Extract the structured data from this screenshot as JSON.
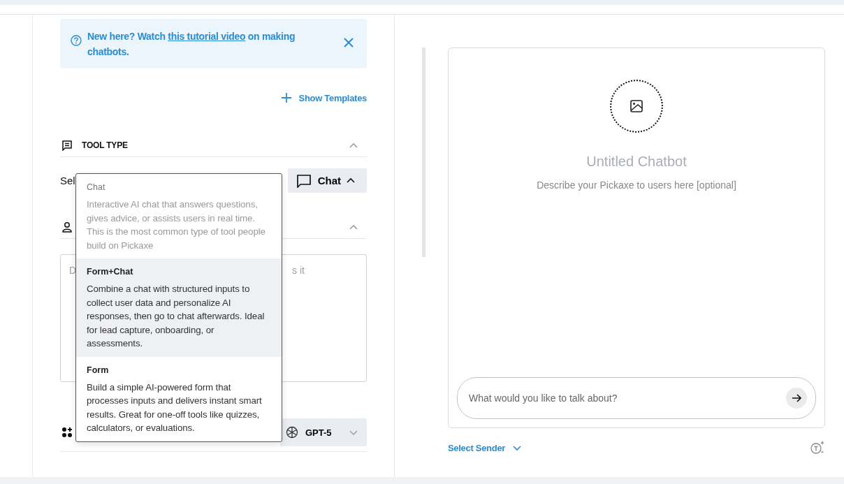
{
  "notice": {
    "text_before": "New here? Watch ",
    "link": "this tutorial video",
    "text_after": " on making chatbots."
  },
  "show_templates": "Show Templates",
  "tool_type": {
    "title": "TOOL TYPE",
    "expanded": true,
    "label": "Sel",
    "button": {
      "label": "Chat",
      "expanded": true
    }
  },
  "dropdown": [
    {
      "title": "Chat",
      "description": "Interactive AI chat that answers questions, gives advice, or assists users in real time. This is the most common type of tool people build on Pickaxe",
      "selected": true,
      "highlighted": false
    },
    {
      "title": "Form+Chat",
      "description": "Combine a chat with structured inputs to collect user data and personalize AI responses, then go to chat afterwards. Ideal for lead capture, onboarding, or assessments.",
      "selected": false,
      "highlighted": true
    },
    {
      "title": "Form",
      "description": "Build a simple AI-powered form that processes inputs and delivers instant smart results. Great for one-off tools like quizzes, calculators, or evaluations.",
      "selected": false,
      "highlighted": false
    }
  ],
  "role_section": {
    "expanded": true,
    "placeholder_start": "D",
    "placeholder_end": "s it"
  },
  "model": {
    "label": "GPT-5",
    "expanded": false
  },
  "preview": {
    "title": "Untitled Chatbot",
    "description": "Describe your Pickaxe to users here [optional]",
    "input_placeholder": "What would you like to talk about?",
    "sender": "Select Sender"
  }
}
